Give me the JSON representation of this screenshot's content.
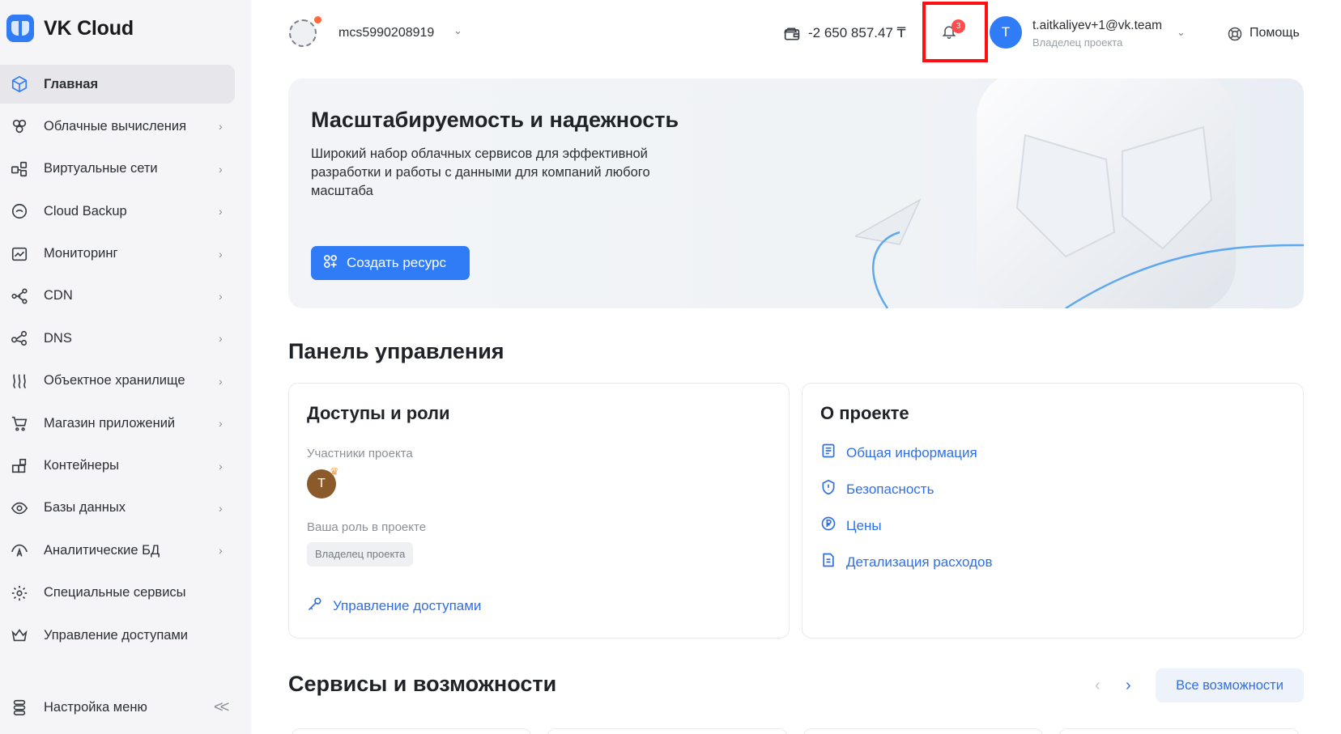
{
  "brand": {
    "name": "VK Cloud"
  },
  "sidebar": {
    "items": [
      {
        "label": "Главная",
        "icon": "cube-icon",
        "active": true
      },
      {
        "label": "Облачные вычисления",
        "icon": "cloud-compute-icon"
      },
      {
        "label": "Виртуальные сети",
        "icon": "network-icon"
      },
      {
        "label": "Cloud Backup",
        "icon": "backup-icon"
      },
      {
        "label": "Мониторинг",
        "icon": "monitoring-icon"
      },
      {
        "label": "CDN",
        "icon": "cdn-icon"
      },
      {
        "label": "DNS",
        "icon": "dns-icon"
      },
      {
        "label": "Объектное хранилище",
        "icon": "object-storage-icon"
      },
      {
        "label": "Магазин приложений",
        "icon": "app-store-icon"
      },
      {
        "label": "Контейнеры",
        "icon": "containers-icon"
      },
      {
        "label": "Базы данных",
        "icon": "database-icon"
      },
      {
        "label": "Аналитические БД",
        "icon": "analytics-db-icon"
      },
      {
        "label": "Специальные сервисы",
        "icon": "special-services-icon"
      },
      {
        "label": "Управление доступами",
        "icon": "access-crown-icon"
      }
    ],
    "chevron": "›",
    "menu_settings": "Настройка меню",
    "collapse": "<<"
  },
  "header": {
    "project": "mcs5990208919",
    "balance": "-2 650 857.47 ₸",
    "notifications_count": "3",
    "user_initial": "T",
    "user_email": "t.aitkaliyev+1@vk.team",
    "user_role": "Владелец проекта",
    "help": "Помощь",
    "chevron": "⌄"
  },
  "hero": {
    "title": "Масштабируемость и надежность",
    "text": "Широкий набор облачных сервисов для эффективной разработки и работы с данными для компаний любого масштаба",
    "button": "Создать ресурс"
  },
  "dashboard": {
    "title": "Панель управления",
    "access_card": {
      "title": "Доступы и роли",
      "members_label": "Участники проекта",
      "member_initial": "T",
      "role_label": "Ваша роль в проекте",
      "role_value": "Владелец проекта",
      "manage_link": "Управление доступами"
    },
    "project_card": {
      "title": "О проекте",
      "links": [
        "Общая информация",
        "Безопасность",
        "Цены",
        "Детализация расходов"
      ]
    }
  },
  "services": {
    "title": "Сервисы и возможности",
    "prev": "‹",
    "next": "›",
    "all_button": "Все возможности"
  },
  "colors": {
    "accent": "#2f7cf6",
    "highlight": "#ff1010",
    "sidebar_bg": "#f5f5f7"
  }
}
